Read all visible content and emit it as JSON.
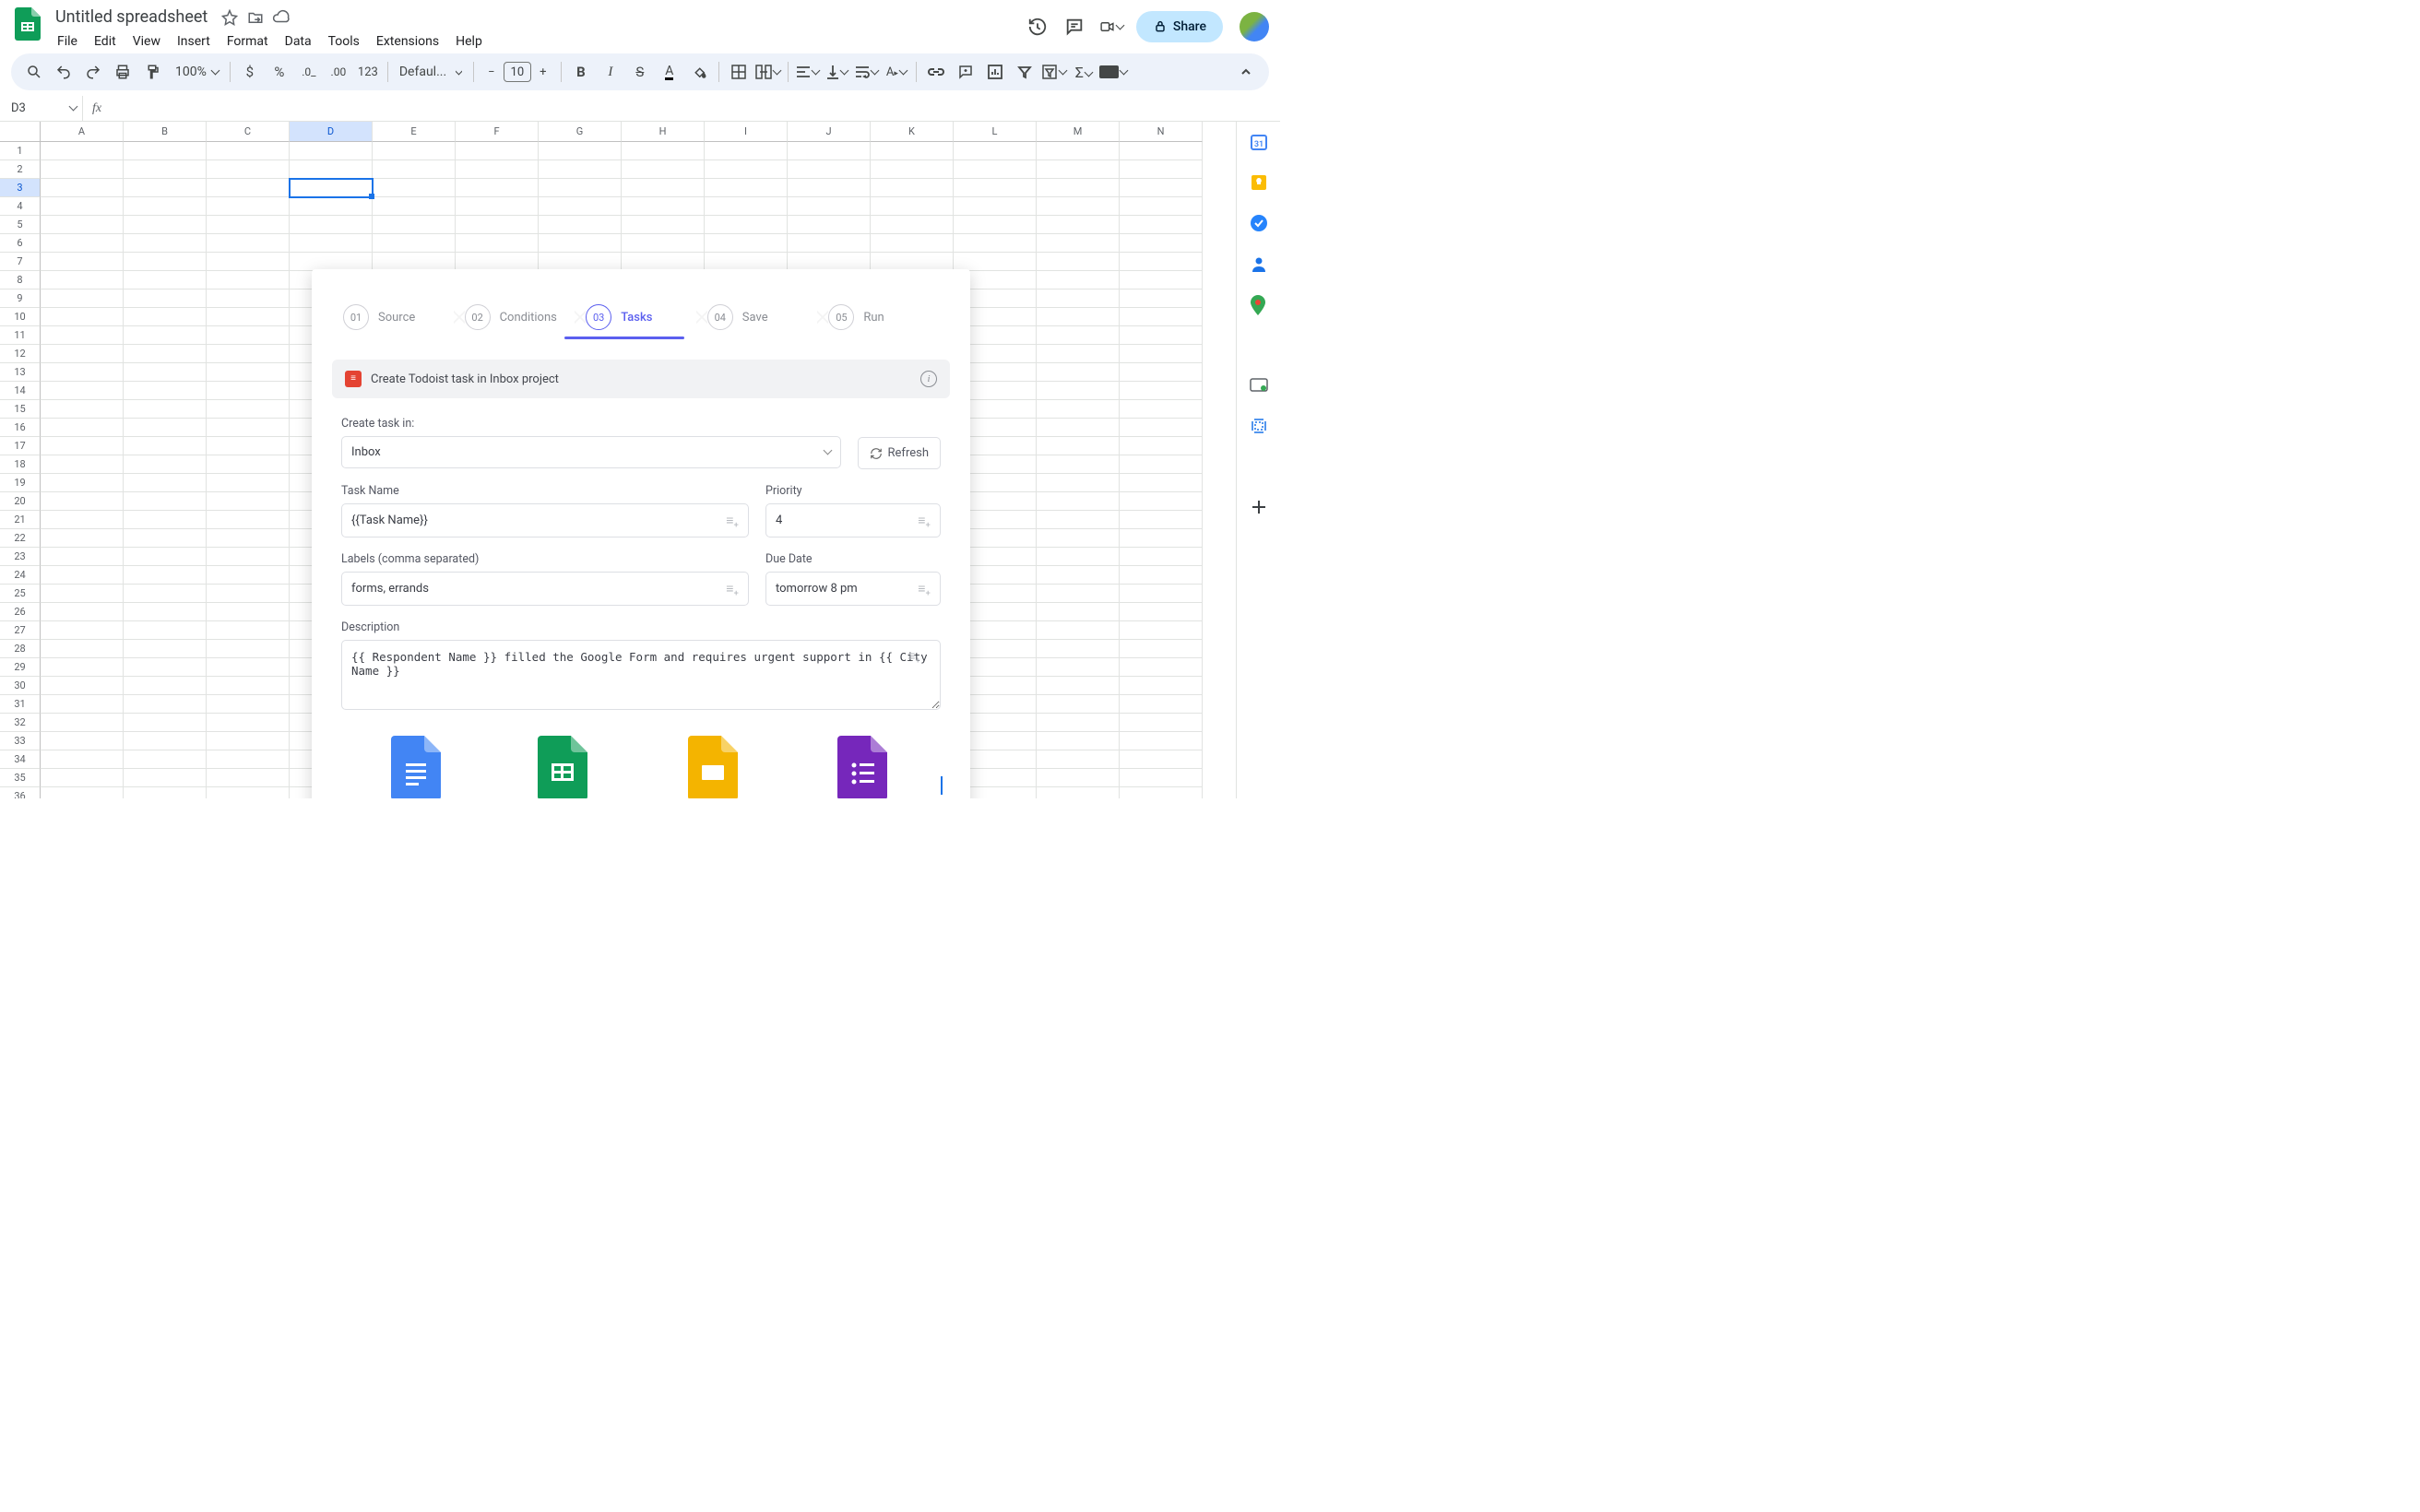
{
  "doc": {
    "title": "Untitled spreadsheet"
  },
  "menubar": [
    "File",
    "Edit",
    "View",
    "Insert",
    "Format",
    "Data",
    "Tools",
    "Extensions",
    "Help"
  ],
  "toolbar": {
    "zoom": "100%",
    "font": "Defaul...",
    "font_size": "10"
  },
  "share": {
    "label": "Share"
  },
  "namebox": "D3",
  "columns": [
    "A",
    "B",
    "C",
    "D",
    "E",
    "F",
    "G",
    "H",
    "I",
    "J",
    "K",
    "L",
    "M",
    "N"
  ],
  "active_col_index": 3,
  "row_count": 37,
  "active_row": 3,
  "overlay": {
    "steps": [
      {
        "num": "01",
        "label": "Source"
      },
      {
        "num": "02",
        "label": "Conditions"
      },
      {
        "num": "03",
        "label": "Tasks"
      },
      {
        "num": "04",
        "label": "Save"
      },
      {
        "num": "05",
        "label": "Run"
      }
    ],
    "active_step_index": 2,
    "header": "Create Todoist task in Inbox project",
    "create_in_label": "Create task in:",
    "create_in_value": "Inbox",
    "refresh_label": "Refresh",
    "task_name_label": "Task Name",
    "task_name_value": "{{Task Name}}",
    "priority_label": "Priority",
    "priority_value": "4",
    "labels_label": "Labels (comma separated)",
    "labels_value": "forms, errands",
    "due_label": "Due Date",
    "due_value": "tomorrow 8 pm",
    "desc_label": "Description",
    "desc_value": "{{ Respondent Name }} filled the Google Form and requires urgent support in {{ City Name }}"
  },
  "apps": [
    {
      "brand": "Google",
      "product": "Docs",
      "color": "#4285f4"
    },
    {
      "brand": "Google",
      "product": "Sheets",
      "color": "#0f9d58"
    },
    {
      "brand": "Google",
      "product": "Slides",
      "color": "#f4b400"
    },
    {
      "brand": "Google",
      "product": "Forms",
      "color": "#7627bb"
    }
  ],
  "sidepanel": [
    "calendar",
    "keep",
    "tasks",
    "contacts",
    "maps"
  ]
}
